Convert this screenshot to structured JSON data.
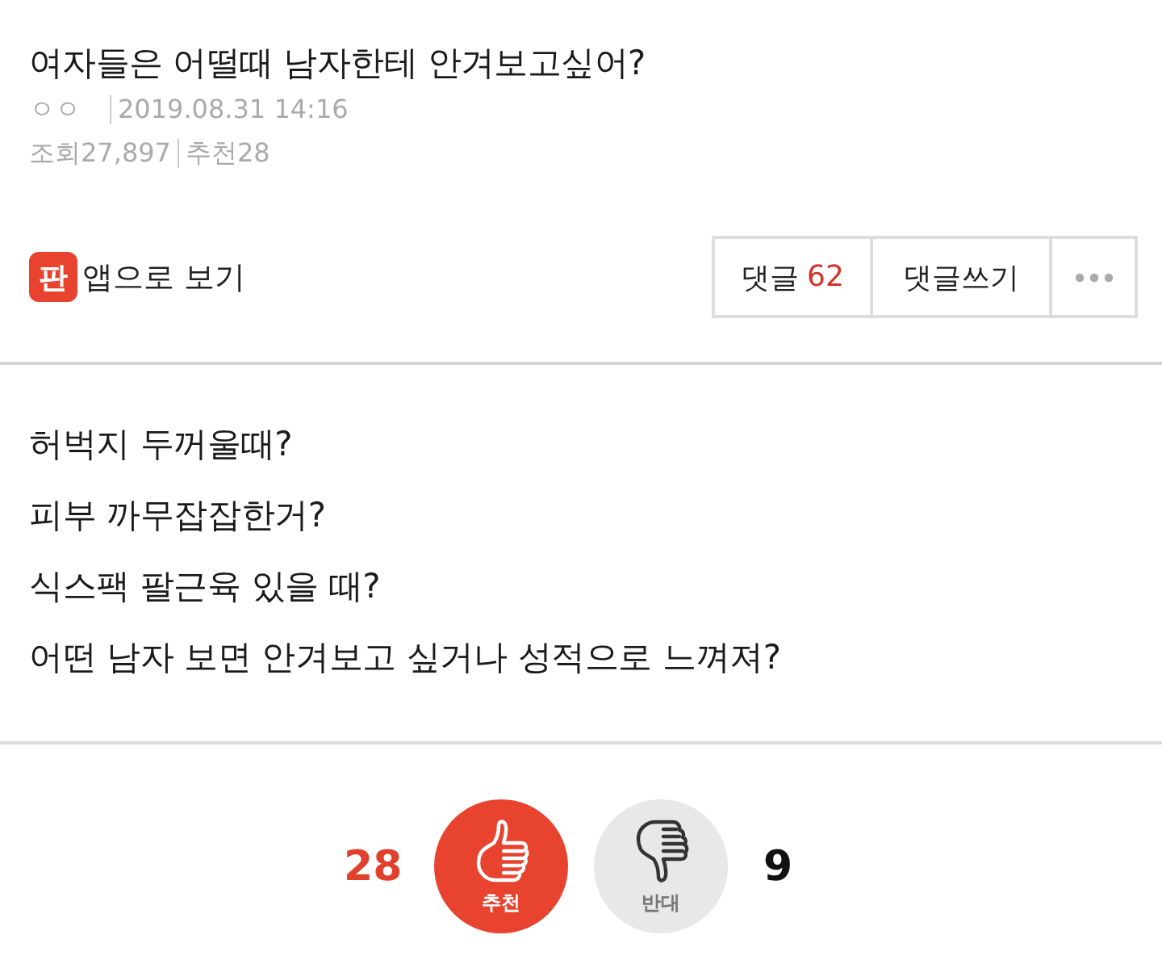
{
  "post": {
    "title": "여자들은 어떨때 남자한테 안겨보고싶어?",
    "author": "ㅇㅇ",
    "date": "2019.08.31 14:16",
    "views": "조회27,897",
    "recommends": "추천28"
  },
  "actions": {
    "app_link": {
      "logo_text": "판",
      "label": "앱으로 보기"
    },
    "buttons": [
      {
        "kind": "comments",
        "label": "댓글",
        "count": "62"
      },
      {
        "kind": "write",
        "label": "댓글쓰기"
      },
      {
        "kind": "more"
      }
    ]
  },
  "body": {
    "lines": [
      "허벅지 두꺼울때?",
      "피부 까무잡잡한거?",
      "식스팩 팔근육 있을 때?",
      "어떤 남자 보면 안겨보고 싶거나 성적으로 느껴져?"
    ]
  },
  "votes": [
    {
      "kind": "up",
      "count": "28",
      "label": "추천"
    },
    {
      "kind": "down",
      "label": "반대",
      "count": "9"
    }
  ]
}
